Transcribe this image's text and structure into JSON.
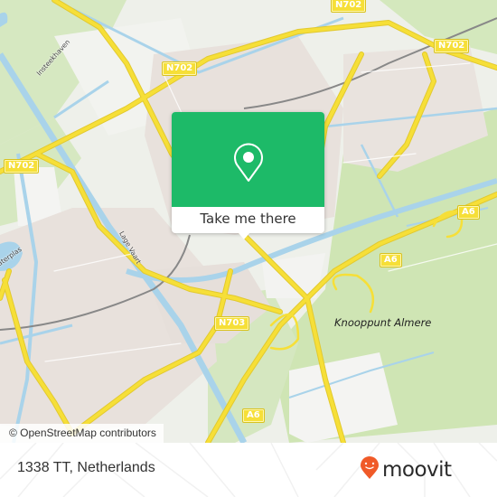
{
  "map": {
    "road_labels": [
      {
        "id": "n702-top",
        "text": "N702"
      },
      {
        "id": "n702-mid",
        "text": "N702"
      },
      {
        "id": "n702-right",
        "text": "N702"
      },
      {
        "id": "n702-left",
        "text": "N702"
      },
      {
        "id": "a6-right",
        "text": "A6"
      },
      {
        "id": "a6-mid",
        "text": "A6"
      },
      {
        "id": "a6-bottom",
        "text": "A6"
      },
      {
        "id": "n703",
        "text": "N703"
      }
    ],
    "place_labels": {
      "knooppunt": "Knooppunt Almere",
      "insteekhaven": "Insteekhaven",
      "lage_vaart": "Lage Vaart",
      "waterplas": "aterplas"
    },
    "colors": {
      "land": "#eef0ea",
      "green": "#cfe5b4",
      "water": "#a9d3ea",
      "road": "#f6df38",
      "urban": "#e8e1dc",
      "popup": "#1dba68",
      "brand": "#f05a28"
    }
  },
  "popup": {
    "icon": "location-pin-icon",
    "button_label": "Take me there"
  },
  "attribution": "© OpenStreetMap contributors",
  "footer": {
    "address": "1338 TT, Netherlands",
    "logo_text": "moovit",
    "logo_icon": "moovit-pin-smile-icon"
  }
}
